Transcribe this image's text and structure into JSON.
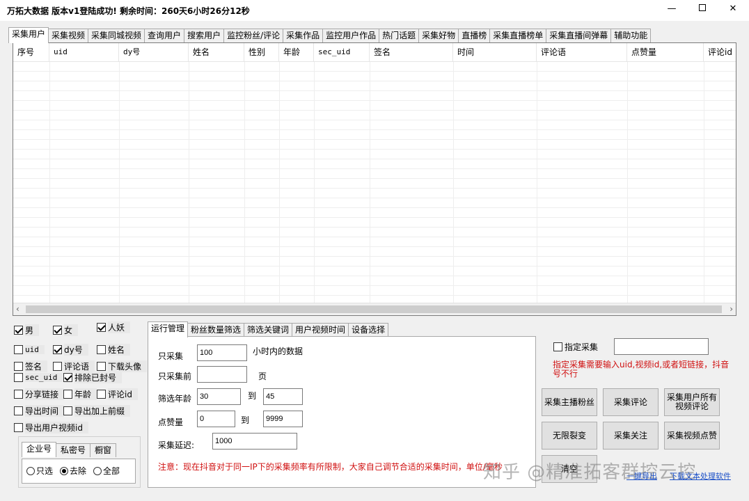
{
  "window": {
    "title": "万拓大数据 版本v1登陆成功! 剩余时间：260天6小时26分12秒",
    "min_glyph": "—",
    "close_glyph": "✕"
  },
  "tabs": [
    "采集用户",
    "采集视频",
    "采集同城视频",
    "查询用户",
    "搜索用户",
    "监控粉丝/评论",
    "采集作品",
    "监控用户作品",
    "热门话题",
    "采集好物",
    "直播榜",
    "采集直播榜单",
    "采集直播间弹幕",
    "辅助功能"
  ],
  "active_tab": "采集用户",
  "table": {
    "columns": [
      "序号",
      "uid",
      "dy号",
      "姓名",
      "性别",
      "年龄",
      "sec_uid",
      "签名",
      "时间",
      "评论语",
      "点赞量",
      "评论id"
    ],
    "rows": []
  },
  "scroll": {
    "left_glyph": "‹",
    "right_glyph": "›"
  },
  "checkboxes": [
    {
      "label": "男",
      "checked": true
    },
    {
      "label": "女",
      "checked": true
    },
    {
      "label": "人妖",
      "checked": true
    },
    {
      "label": "uid",
      "checked": false
    },
    {
      "label": "dy号",
      "checked": true
    },
    {
      "label": "姓名",
      "checked": false
    },
    {
      "label": "签名",
      "checked": false
    },
    {
      "label": "评论语",
      "checked": false
    },
    {
      "label": "下载头像",
      "checked": false
    },
    {
      "label": "sec_uid",
      "checked": false
    },
    {
      "label": "排除已封号",
      "checked": true
    },
    {
      "label": "分享链接",
      "checked": false
    },
    {
      "label": "年龄",
      "checked": false
    },
    {
      "label": "评论id",
      "checked": false
    },
    {
      "label": "导出时间",
      "checked": false
    },
    {
      "label": "导出加上前缀",
      "checked": false
    },
    {
      "label": "导出用户视频id",
      "checked": false
    }
  ],
  "account": {
    "tabs": [
      "企业号",
      "私密号",
      "橱窗"
    ],
    "active_tab": "企业号",
    "options": [
      "只选",
      "去除",
      "全部"
    ],
    "selected": "去除"
  },
  "mid": {
    "tabs": [
      "运行管理",
      "粉丝数量筛选",
      "筛选关键词",
      "用户视频时间",
      "设备选择"
    ],
    "active_tab": "运行管理",
    "only_collect_label": "只采集",
    "only_collect_value": "100",
    "only_collect_suffix": "小时内的数据",
    "before_label": "只采集前",
    "before_value": "",
    "before_suffix": "页",
    "age_label": "筛选年龄",
    "age_from": "30",
    "to_label": "到",
    "age_to": "45",
    "likes_label": "点赞量",
    "likes_from": "0",
    "likes_to": "9999",
    "delay_label": "采集延迟:",
    "delay_value": "1000",
    "notice": "注意：现在抖音对于同一IP下的采集频率有所限制，大家自己调节合适的采集时间，单位/毫秒"
  },
  "right": {
    "spec_label": "指定采集",
    "spec_value": "",
    "spec_note": "指定采集需要输入uid,视频id,或者短链接，抖音号不行",
    "buttons": [
      "采集主播粉丝",
      "采集评论",
      "采集用户所有视频评论",
      "无限裂变",
      "采集关注",
      "采集视频点赞",
      "清空"
    ],
    "link_a": "一键导出",
    "link_b": "下载文本处理软件"
  },
  "watermark": "知乎 @精准拓客群控云控"
}
